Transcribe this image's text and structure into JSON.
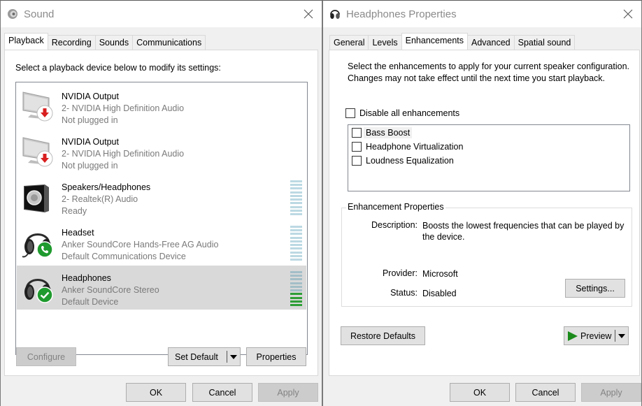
{
  "sound_window": {
    "title": "Sound",
    "title_icon": "speaker-icon",
    "tabs": [
      {
        "label": "Playback",
        "active": true
      },
      {
        "label": "Recording",
        "active": false
      },
      {
        "label": "Sounds",
        "active": false
      },
      {
        "label": "Communications",
        "active": false
      }
    ],
    "intro": "Select a playback device below to modify its settings:",
    "devices": [
      {
        "name": "NVIDIA Output",
        "driver": "2- NVIDIA High Definition Audio",
        "status": "Not plugged in",
        "icon": "monitor-icon",
        "badge": "unplugged-icon",
        "selected": false,
        "has_meter": false,
        "meter_level": null
      },
      {
        "name": "NVIDIA Output",
        "driver": "2- NVIDIA High Definition Audio",
        "status": "Not plugged in",
        "icon": "monitor-icon",
        "badge": "unplugged-icon",
        "selected": false,
        "has_meter": false,
        "meter_level": null
      },
      {
        "name": "Speakers/Headphones",
        "driver": "2- Realtek(R) Audio",
        "status": "Ready",
        "icon": "speaker-icon",
        "badge": null,
        "selected": false,
        "has_meter": true,
        "meter_level": 0
      },
      {
        "name": "Headset",
        "driver": "Anker SoundCore Hands-Free AG Audio",
        "status": "Default Communications Device",
        "icon": "headset-icon",
        "badge": "phone-badge-icon",
        "selected": false,
        "has_meter": true,
        "meter_level": 0
      },
      {
        "name": "Headphones",
        "driver": "Anker SoundCore Stereo",
        "status": "Default Device",
        "icon": "headphones-icon",
        "badge": "check-badge-icon",
        "selected": true,
        "has_meter": true,
        "meter_level": 0.4
      }
    ],
    "buttons": {
      "configure": "Configure",
      "set_default": "Set Default",
      "properties": "Properties",
      "ok": "OK",
      "cancel": "Cancel",
      "apply": "Apply"
    }
  },
  "props_window": {
    "title": "Headphones Properties",
    "title_icon": "headphones-icon",
    "tabs": [
      {
        "label": "General",
        "active": false
      },
      {
        "label": "Levels",
        "active": false
      },
      {
        "label": "Enhancements",
        "active": true
      },
      {
        "label": "Advanced",
        "active": false
      },
      {
        "label": "Spatial sound",
        "active": false
      }
    ],
    "intro": "Select the enhancements to apply for your current speaker configuration. Changes may not take effect until the next time you start playback.",
    "disable_all": {
      "label": "Disable all enhancements",
      "checked": false
    },
    "enhancements": [
      {
        "label": "Bass Boost",
        "checked": false,
        "focused": true
      },
      {
        "label": "Headphone Virtualization",
        "checked": false,
        "focused": false
      },
      {
        "label": "Loudness Equalization",
        "checked": false,
        "focused": false
      }
    ],
    "group": {
      "title": "Enhancement Properties",
      "description_label": "Description:",
      "description": "Boosts the lowest frequencies that can be played by the device.",
      "provider_label": "Provider:",
      "provider": "Microsoft",
      "status_label": "Status:",
      "status": "Disabled",
      "settings_button": "Settings..."
    },
    "buttons": {
      "restore_defaults": "Restore Defaults",
      "preview": "Preview",
      "ok": "OK",
      "cancel": "Cancel",
      "apply": "Apply"
    }
  },
  "colors": {
    "meter_idle": "#bcd9e3",
    "meter_lit": "#2e9e37",
    "badge_green": "#1f9a2e",
    "badge_red": "#d81e1e"
  }
}
